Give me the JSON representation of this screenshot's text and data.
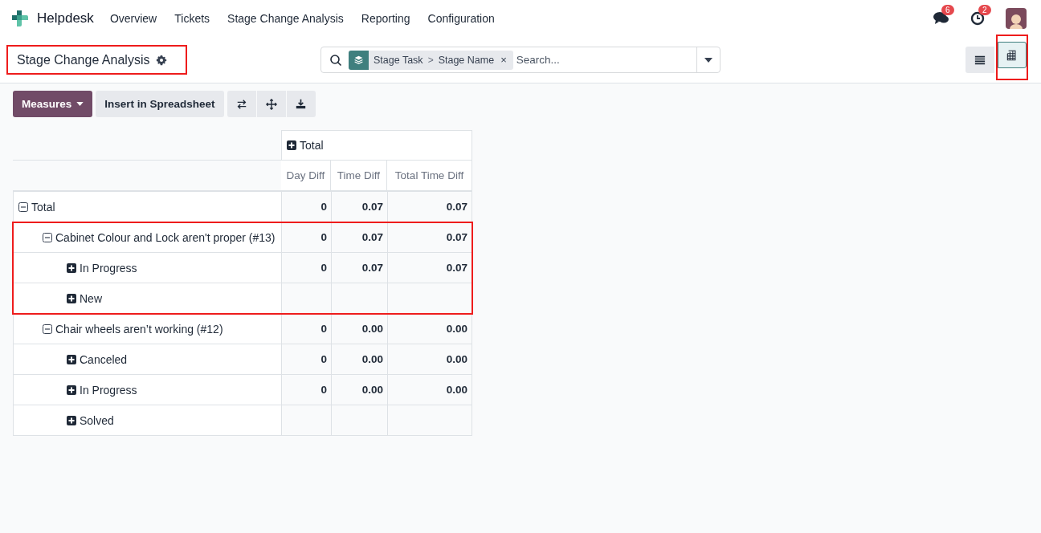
{
  "navbar": {
    "app_name": "Helpdesk",
    "menu": [
      {
        "label": "Overview"
      },
      {
        "label": "Tickets"
      },
      {
        "label": "Stage Change Analysis"
      },
      {
        "label": "Reporting"
      },
      {
        "label": "Configuration"
      }
    ],
    "messages_count": "6",
    "activities_count": "2"
  },
  "control_panel": {
    "title": "Stage Change Analysis",
    "title_highlighted": true,
    "search": {
      "facet": {
        "field": "Stage Task",
        "separator": ">",
        "value": "Stage Name",
        "remove": "×"
      },
      "placeholder": "Search..."
    },
    "views": [
      {
        "kind": "list",
        "selected": false,
        "highlighted": false
      },
      {
        "kind": "pivot",
        "selected": true,
        "highlighted": true
      }
    ]
  },
  "toolbar": {
    "measures": "Measures",
    "insert": "Insert in Spreadsheet"
  },
  "pivot": {
    "column_header": {
      "label": "Total",
      "expanded": false
    },
    "measures": [
      "Day Diff",
      "Time Diff",
      "Total Time Diff"
    ],
    "rows": [
      {
        "label": "Total",
        "expanded": true,
        "values": [
          "0",
          "0.07",
          "0.07"
        ],
        "children": [
          {
            "label": "Cabinet Colour and Lock aren't proper (#13)",
            "expanded": true,
            "values": [
              "0",
              "0.07",
              "0.07"
            ],
            "highlighted": true,
            "children": [
              {
                "label": "In Progress",
                "expanded": false,
                "values": [
                  "0",
                  "0.07",
                  "0.07"
                ]
              },
              {
                "label": "New",
                "expanded": false
              }
            ]
          },
          {
            "label": "Chair wheels aren’t working (#12)",
            "expanded": true,
            "values": [
              "0",
              "0.00",
              "0.00"
            ],
            "children": [
              {
                "label": "Canceled",
                "expanded": false,
                "values": [
                  "0",
                  "0.00",
                  "0.00"
                ]
              },
              {
                "label": "In Progress",
                "expanded": false,
                "values": [
                  "0",
                  "0.00",
                  "0.00"
                ]
              },
              {
                "label": "Solved",
                "expanded": false
              }
            ]
          }
        ]
      }
    ]
  }
}
